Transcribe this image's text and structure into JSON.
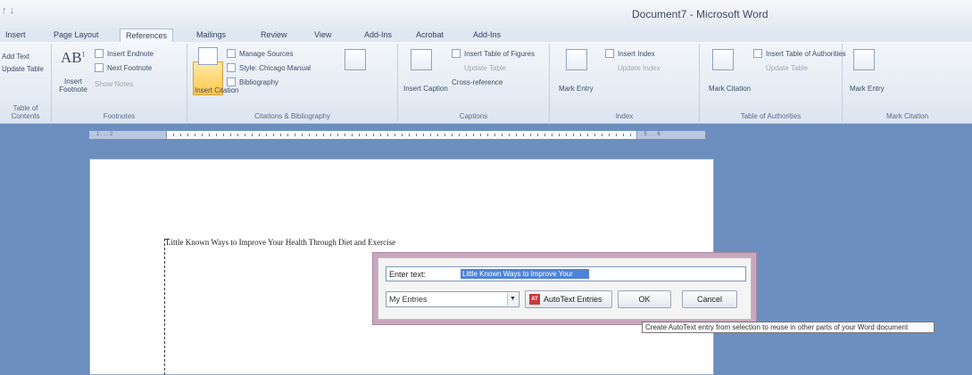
{
  "window": {
    "title": "Document7 - Microsoft Word",
    "quick_access": "↑ ↓"
  },
  "tabs": [
    "Insert",
    "Page Layout",
    "References",
    "Mailings",
    "Review",
    "View",
    "Add-Ins",
    "Acrobat",
    "Add-Ins"
  ],
  "ribbon": {
    "toc": {
      "add_text": "Add Text",
      "update_table": "Update Table",
      "label": "Table of Contents"
    },
    "footnotes": {
      "insert_endnote": "Insert Endnote",
      "next_footnote": "Next Footnote",
      "show_notes": "Show Notes",
      "insert_footnote": "Insert Footnote",
      "ab_glyph": "AB",
      "ab_sup": "1",
      "label": "Footnotes"
    },
    "citations": {
      "insert_citation": "Insert Citation",
      "style": "Style: Chicago Manual",
      "manage_sources": "Manage Sources",
      "bibliography": "Bibliography",
      "label": "Citations & Bibliography"
    },
    "captions": {
      "insert_caption": "Insert Caption",
      "insert_table_of_figures": "Insert Table of Figures",
      "update_table": "Update Table",
      "cross_reference": "Cross-reference",
      "label": "Captions"
    },
    "index": {
      "mark_entry": "Mark Entry",
      "insert_index": "Insert Index",
      "update_index": "Update Index",
      "label": "Index"
    },
    "authorities": {
      "mark_citation": "Mark Citation",
      "insert_table": "Insert Table of Authorities",
      "update_table": "Update Table",
      "label": "Table of Authorities"
    },
    "acrobat": {
      "mark_entry": "Mark Entry",
      "label": "Mark Citation"
    }
  },
  "ruler": {
    "left_text": "1 . . . 2",
    "right_text": ". 5 . . . 6"
  },
  "document": {
    "line1": "Little Known Ways to Improve Your Health Through Diet and Exercise"
  },
  "autotext_dialog": {
    "field_label": "Enter text:",
    "field_selected": "Little Known Ways to Improve Your",
    "combo_value": "My Entries",
    "autotext_button": "AutoText Entries",
    "autotext_icon": "AT",
    "ok_button": "OK",
    "cancel_button": "Cancel",
    "tooltip": "Create AutoText entry from selection to reuse in other parts of your Word document"
  }
}
